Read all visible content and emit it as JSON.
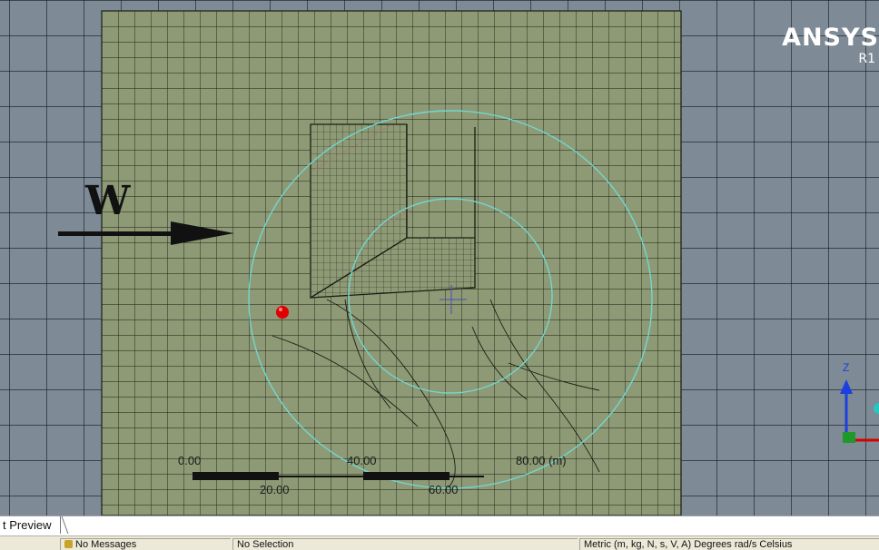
{
  "viewer": {
    "brand_name": "ANSYS",
    "brand_release": "R1",
    "wind_label": "W",
    "scale_top_labels": [
      "0.00",
      "40.00",
      "80.00 (m)"
    ],
    "scale_bottom_labels": [
      "20.00",
      "60.00"
    ],
    "triad_axis_label": "Z"
  },
  "tabs": [
    {
      "label": "t Preview"
    }
  ],
  "status_bar": {
    "messages": "No Messages",
    "selection": "No Selection",
    "units": "Metric (m, kg, N, s, V, A)   Degrees   rad/s   Celsius"
  },
  "colors": {
    "mesh_fill": "#8e9a75",
    "mesh_line": "#1a1d14",
    "background": "#7e8a96",
    "sphere_lines": "#72d6d0",
    "probe_point": "#e00000"
  }
}
